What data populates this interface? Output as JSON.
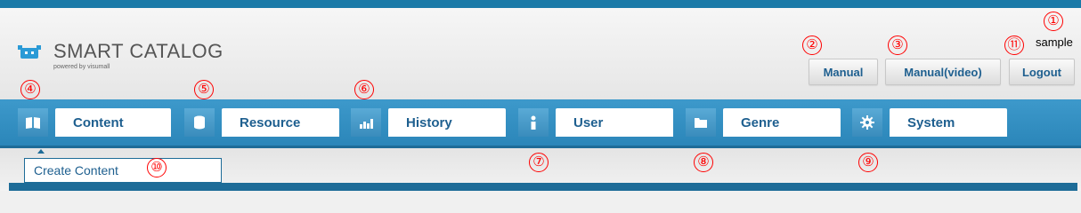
{
  "header": {
    "logo_name": "SMART CATALOG",
    "logo_sub": "powered by visumall",
    "username": "sample",
    "buttons": {
      "manual": "Manual",
      "manual_video": "Manual(video)",
      "logout": "Logout"
    }
  },
  "nav": {
    "items": [
      {
        "label": "Content",
        "icon": "book-icon"
      },
      {
        "label": "Resource",
        "icon": "database-icon"
      },
      {
        "label": "History",
        "icon": "bar-chart-icon"
      },
      {
        "label": "User",
        "icon": "user-icon"
      },
      {
        "label": "Genre",
        "icon": "folder-icon"
      },
      {
        "label": "System",
        "icon": "gear-icon"
      }
    ]
  },
  "submenu": {
    "items": [
      "Create Content"
    ]
  },
  "callouts": [
    "①",
    "②",
    "③",
    "④",
    "⑤",
    "⑥",
    "⑦",
    "⑧",
    "⑨",
    "⑩",
    "⑪"
  ],
  "colors": {
    "accent": "#1a7aa8",
    "nav_bar": "#3d99cb",
    "label_text": "#1e5f8f",
    "callout": "#ff0000"
  }
}
